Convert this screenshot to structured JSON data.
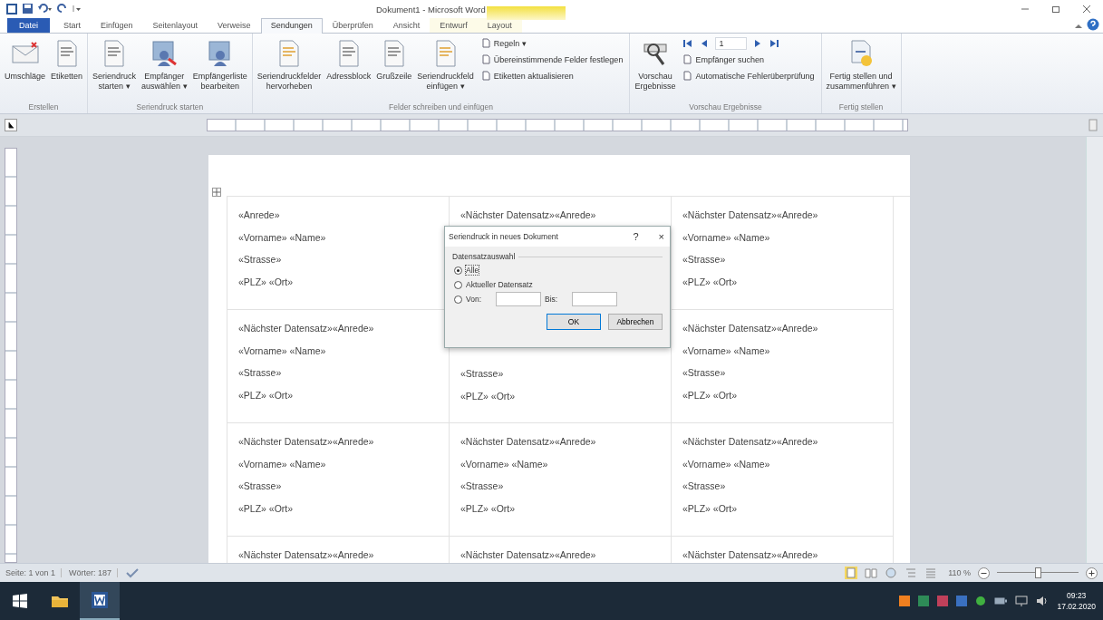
{
  "window": {
    "title": "Dokument1 - Microsoft Word"
  },
  "tabs": [
    {
      "label": "Datei",
      "kind": "file",
      "selected": false
    },
    {
      "label": "Start",
      "kind": "normal",
      "selected": false
    },
    {
      "label": "Einfügen",
      "kind": "normal",
      "selected": false
    },
    {
      "label": "Seitenlayout",
      "kind": "normal",
      "selected": false
    },
    {
      "label": "Verweise",
      "kind": "normal",
      "selected": false
    },
    {
      "label": "Sendungen",
      "kind": "normal",
      "selected": true
    },
    {
      "label": "Überprüfen",
      "kind": "normal",
      "selected": false
    },
    {
      "label": "Ansicht",
      "kind": "normal",
      "selected": false
    },
    {
      "label": "Entwurf",
      "kind": "contextual",
      "selected": false
    },
    {
      "label": "Layout",
      "kind": "contextual",
      "selected": false
    }
  ],
  "ribbon": [
    {
      "label": "Erstellen",
      "items": [
        {
          "kind": "large",
          "lines": [
            "Umschläge"
          ]
        },
        {
          "kind": "large",
          "lines": [
            "Etiketten"
          ]
        }
      ]
    },
    {
      "label": "Seriendruck starten",
      "items": [
        {
          "kind": "large",
          "lines": [
            "Seriendruck",
            "starten ▾"
          ]
        },
        {
          "kind": "large",
          "lines": [
            "Empfänger",
            "auswählen ▾"
          ]
        },
        {
          "kind": "large",
          "lines": [
            "Empfängerliste",
            "bearbeiten"
          ]
        }
      ]
    },
    {
      "label": "Felder schreiben und einfügen",
      "items": [
        {
          "kind": "large",
          "lines": [
            "Seriendruckfelder",
            "hervorheben"
          ]
        },
        {
          "kind": "large",
          "lines": [
            "Adressblock"
          ]
        },
        {
          "kind": "large",
          "lines": [
            "Grußzeile"
          ]
        },
        {
          "kind": "large",
          "lines": [
            "Seriendruckfeld",
            "einfügen ▾"
          ]
        },
        {
          "kind": "small",
          "items": [
            "Regeln ▾",
            "Übereinstimmende Felder festlegen",
            "Etiketten aktualisieren"
          ]
        }
      ]
    },
    {
      "label": "Vorschau Ergebnisse",
      "items": [
        {
          "kind": "large",
          "lines": [
            "Vorschau",
            "Ergebnisse"
          ]
        },
        {
          "kind": "nav",
          "record": "1",
          "items": [
            "Empfänger suchen",
            "Automatische Fehlerüberprüfung"
          ]
        }
      ]
    },
    {
      "label": "Fertig stellen",
      "items": [
        {
          "kind": "large",
          "lines": [
            "Fertig stellen und",
            "zusammenführen ▾"
          ]
        }
      ]
    }
  ],
  "table": {
    "rows": [
      [
        {
          "lines": [
            "«Anrede»",
            "«Vorname» «Name»",
            "«Strasse»",
            "«PLZ» «Ort»"
          ]
        },
        {
          "lines": [
            "«Nächster Datensatz»«Anrede»"
          ]
        },
        {
          "lines": [
            "«Nächster Datensatz»«Anrede»",
            "«Vorname» «Name»",
            "«Strasse»",
            "«PLZ» «Ort»"
          ]
        }
      ],
      [
        {
          "lines": [
            "«Nächster Datensatz»«Anrede»",
            "«Vorname» «Name»",
            "«Strasse»",
            "«PLZ» «Ort»"
          ]
        },
        {
          "lines": [
            "«Strasse»",
            "«PLZ» «Ort»"
          ]
        },
        {
          "lines": [
            "«Nächster Datensatz»«Anrede»",
            "«Vorname» «Name»",
            "«Strasse»",
            "«PLZ» «Ort»"
          ]
        }
      ],
      [
        {
          "lines": [
            "«Nächster Datensatz»«Anrede»",
            "«Vorname» «Name»",
            "«Strasse»",
            "«PLZ» «Ort»"
          ]
        },
        {
          "lines": [
            "«Nächster Datensatz»«Anrede»",
            "«Vorname» «Name»",
            "«Strasse»",
            "«PLZ» «Ort»"
          ]
        },
        {
          "lines": [
            "«Nächster Datensatz»«Anrede»",
            "«Vorname» «Name»",
            "«Strasse»",
            "«PLZ» «Ort»"
          ]
        }
      ],
      [
        {
          "lines": [
            "«Nächster Datensatz»«Anrede»"
          ]
        },
        {
          "lines": [
            "«Nächster Datensatz»«Anrede»"
          ]
        },
        {
          "lines": [
            "«Nächster Datensatz»«Anrede»"
          ]
        }
      ]
    ]
  },
  "dialog": {
    "title": "Seriendruck in neues Dokument",
    "help": "?",
    "close": "×",
    "group": "Datensatzauswahl",
    "options": [
      {
        "label": "Alle",
        "selected": true
      },
      {
        "label": "Aktueller Datensatz",
        "selected": false
      },
      {
        "label": "Von:",
        "selected": false,
        "to_label": "Bis:"
      }
    ],
    "buttons": [
      "OK",
      "Abbrechen"
    ]
  },
  "status_bar": {
    "page": "Seite: 1 von 1",
    "words": "Wörter: 187",
    "zoom": "110 %",
    "zoom_slider": {
      "level": 0.5
    }
  },
  "taskbar": {
    "apps": [
      {
        "kind": "start"
      },
      {
        "kind": "explorer"
      },
      {
        "kind": "word",
        "selected": true
      }
    ],
    "time": "09:23",
    "date": "17.02.2020"
  }
}
